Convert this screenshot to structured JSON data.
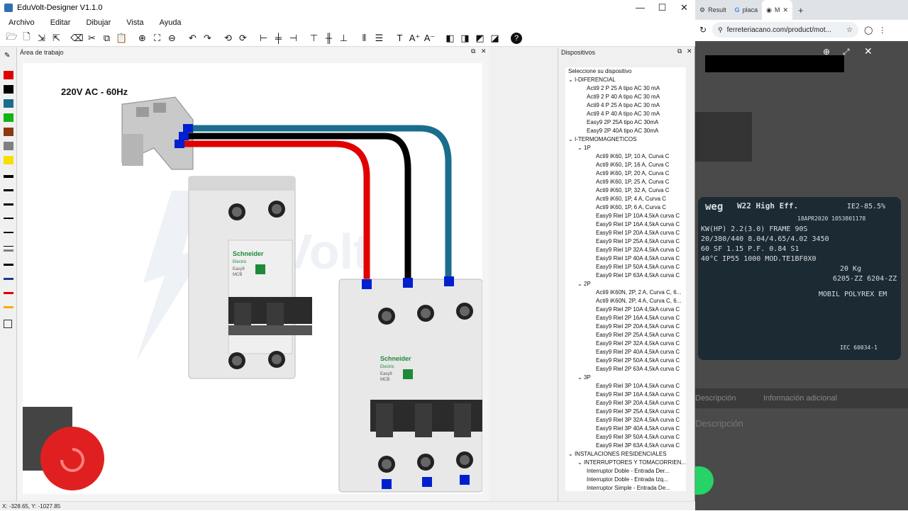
{
  "window": {
    "title": "EduVolt-Designer V1.1.0",
    "min": "—",
    "max": "☐",
    "close": "✕"
  },
  "menu": [
    "Archivo",
    "Editar",
    "Dibujar",
    "Vista",
    "Ayuda"
  ],
  "toolbar_icons": [
    "open-folder-icon",
    "new-file-icon",
    "import-icon",
    "export-icon",
    "eraser-icon",
    "cut-icon",
    "copy-icon",
    "paste-icon",
    "zoom-in-icon",
    "fit-icon",
    "zoom-out-icon",
    "undo-icon",
    "redo-icon",
    "rotate-left-icon",
    "rotate-right-icon",
    "align-left-icon",
    "align-center-icon",
    "align-right-icon",
    "align-top-icon",
    "align-middle-icon",
    "align-bottom-icon",
    "distribute-h-icon",
    "distribute-v-icon",
    "text-icon",
    "font-up-icon",
    "font-down-icon",
    "bring-front-icon",
    "send-back-icon",
    "group-icon",
    "ungroup-icon",
    "help-icon"
  ],
  "palette_colors": [
    "#e00000",
    "#000000",
    "#1a6e8c",
    "#12b312",
    "#8b3a12",
    "#808080",
    "#f5e000"
  ],
  "work_panel": {
    "title": "Área de trabajo"
  },
  "canvas": {
    "label": "220V AC - 60Hz",
    "watermark": "EduVolt",
    "brand1": "Schneider",
    "brand1b": "Electric",
    "model1": "Easy9",
    "model1b": "MCB",
    "brand2": "Schneider",
    "brand2b": "Electric",
    "model2": "Easy9",
    "model2b": "MCB",
    "wire_colors": {
      "phase": "#e00000",
      "neutral": "#000000",
      "other": "#1a6e8c",
      "terminal": "#0020d0"
    }
  },
  "device_panel": {
    "title": "Dispositivos",
    "prompt": "Seleccione su dispositivo",
    "items": [
      {
        "t": "I-DIFERENCIAL",
        "lvl": 0,
        "exp": "⌄"
      },
      {
        "t": "Acti9 2 P 25 A tipo AC 30 mA",
        "lvl": 2
      },
      {
        "t": "Acti9 2 P 40 A tipo AC 30 mA",
        "lvl": 2
      },
      {
        "t": "Acti9 4 P 25 A tipo AC 30 mA",
        "lvl": 2
      },
      {
        "t": "Acti9 4 P 40 A tipo AC 30 mA",
        "lvl": 2
      },
      {
        "t": "Easy9 2P 25A tipo AC 30mA",
        "lvl": 2
      },
      {
        "t": "Easy9 2P 40A tipo AC 30mA",
        "lvl": 2
      },
      {
        "t": "I-TERMOMAGNETICOS",
        "lvl": 0,
        "exp": "⌄"
      },
      {
        "t": "1P",
        "lvl": 1,
        "exp": "⌄"
      },
      {
        "t": "Acti9 iK60, 1P, 10 A, Curva C",
        "lvl": 3
      },
      {
        "t": "Acti9 iK60, 1P, 16 A, Curva C",
        "lvl": 3
      },
      {
        "t": "Acti9 iK60, 1P, 20 A, Curva C",
        "lvl": 3
      },
      {
        "t": "Acti9 iK60, 1P, 25 A, Curva C",
        "lvl": 3
      },
      {
        "t": "Acti9 iK60, 1P, 32 A, Curva C",
        "lvl": 3
      },
      {
        "t": "Acti9 iK60, 1P, 4 A, Curva C",
        "lvl": 3
      },
      {
        "t": "Acti9 iK60, 1P, 6 A, Curva C",
        "lvl": 3
      },
      {
        "t": "Easy9 Riel 1P 10A 4,5kA curva C",
        "lvl": 3
      },
      {
        "t": "Easy9 Riel 1P 16A 4,5kA curva C",
        "lvl": 3
      },
      {
        "t": "Easy9 Riel 1P 20A 4,5kA curva C",
        "lvl": 3
      },
      {
        "t": "Easy9 Riel 1P 25A 4,5kA curva C",
        "lvl": 3
      },
      {
        "t": "Easy9 Riel 1P 32A 4,5kA curva C",
        "lvl": 3
      },
      {
        "t": "Easy9 Riel 1P 40A 4,5kA curva C",
        "lvl": 3
      },
      {
        "t": "Easy9 Riel 1P 50A 4,5kA curva C",
        "lvl": 3
      },
      {
        "t": "Easy9 Riel 1P 63A 4,5kA curva C",
        "lvl": 3
      },
      {
        "t": "2P",
        "lvl": 1,
        "exp": "⌄"
      },
      {
        "t": "Acti9 iK60N, 2P, 2 A, Curva C, 6...",
        "lvl": 3
      },
      {
        "t": "Acti9 iK60N, 2P, 4 A, Curva C, 6...",
        "lvl": 3
      },
      {
        "t": "Easy9 Riel 2P 10A 4,5kA curva C",
        "lvl": 3
      },
      {
        "t": "Easy9 Riel 2P 16A 4,5kA curva C",
        "lvl": 3
      },
      {
        "t": "Easy9 Riel 2P 20A 4,5kA curva C",
        "lvl": 3
      },
      {
        "t": "Easy9 Riel 2P 25A 4,5kA curva C",
        "lvl": 3
      },
      {
        "t": "Easy9 Riel 2P 32A 4,5kA curva C",
        "lvl": 3
      },
      {
        "t": "Easy9 Riel 2P 40A 4,5kA curva C",
        "lvl": 3
      },
      {
        "t": "Easy9 Riel 2P 50A 4,5kA curva C",
        "lvl": 3
      },
      {
        "t": "Easy9 Riel 2P 63A 4,5kA curva C",
        "lvl": 3
      },
      {
        "t": "3P",
        "lvl": 1,
        "exp": "⌄"
      },
      {
        "t": "Easy9 Riel 3P 10A 4,5kA curva C",
        "lvl": 3
      },
      {
        "t": "Easy9 Riel 3P 16A 4,5kA curva C",
        "lvl": 3
      },
      {
        "t": "Easy9 Riel 3P 20A 4,5kA curva C",
        "lvl": 3
      },
      {
        "t": "Easy9 Riel 3P 25A 4,5kA curva C",
        "lvl": 3
      },
      {
        "t": "Easy9 Riel 3P 32A 4,5kA curva C",
        "lvl": 3
      },
      {
        "t": "Easy9 Riel 3P 40A 4,5kA curva C",
        "lvl": 3
      },
      {
        "t": "Easy9 Riel 3P 50A 4,5kA curva C",
        "lvl": 3
      },
      {
        "t": "Easy9 Riel 3P 63A 4,5kA curva C",
        "lvl": 3
      },
      {
        "t": "INSTALACIONES RESIDENCIALES",
        "lvl": 0,
        "exp": "⌄"
      },
      {
        "t": "INTERRUPTORES Y TOMACORRIEN...",
        "lvl": 1,
        "exp": "⌄"
      },
      {
        "t": "Interruptor Doble - Entrada Der...",
        "lvl": 2
      },
      {
        "t": "Interruptor Doble - Entrada Izq...",
        "lvl": 2
      },
      {
        "t": "Interruptor Simple - Entrada De...",
        "lvl": 2
      }
    ]
  },
  "status": {
    "coords": "X: -328.65, Y: -1027.85"
  },
  "browser": {
    "tab1": "Result",
    "tab2": "placa",
    "tab3": "M",
    "url": "ferreteriacano.com/product/mot...",
    "desc_tab": "Descripción",
    "info_tab": "Información adicional",
    "desc_title": "Descripción",
    "plate_brand": "weg",
    "plate_model": "W22 High Eff.",
    "plate_ie": "IE2-85.5%",
    "plate_date": "18APR2020  1053801178",
    "plate_row1": "KW(HP) 2.2(3.0)  FRAME 90S",
    "plate_row2": "20/380/440  8.04/4.65/4.02  3450",
    "plate_row3": "60  SF 1.15  P.F. 0.84  S1",
    "plate_row4": "40°C  IP55  1000  MOD.TE1BF0X0",
    "plate_row5": "20 Kg",
    "plate_row6": "6205-ZZ  6204-ZZ",
    "plate_row7": "MOBIL POLYREX EM",
    "plate_iec": "IEC 60034-1"
  }
}
